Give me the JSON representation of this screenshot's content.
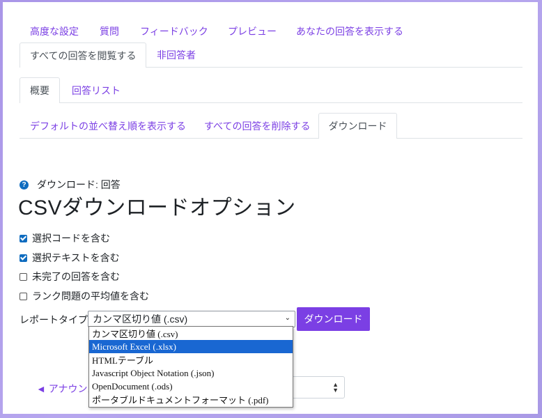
{
  "tabs_row1": [
    {
      "label": "高度な設定"
    },
    {
      "label": "質問"
    },
    {
      "label": "フィードバック"
    },
    {
      "label": "プレビュー"
    },
    {
      "label": "あなたの回答を表示する"
    }
  ],
  "tabs_row2": [
    {
      "label": "すべての回答を閲覧する",
      "active": true
    },
    {
      "label": "非回答者"
    }
  ],
  "tabs_row3": [
    {
      "label": "概要",
      "active": true
    },
    {
      "label": "回答リスト"
    }
  ],
  "tabs_row4": [
    {
      "label": "デフォルトの並べ替え順を表示する"
    },
    {
      "label": "すべての回答を削除する"
    },
    {
      "label": "ダウンロード",
      "active": true
    }
  ],
  "page": {
    "help_icon_glyph": "?",
    "subtitle": "ダウンロード: 回答",
    "title": "CSVダウンロードオプション"
  },
  "options": [
    {
      "label": "選択コードを含む",
      "checked": true
    },
    {
      "label": "選択テキストを含む",
      "checked": true
    },
    {
      "label": "未完了の回答を含む",
      "checked": false
    },
    {
      "label": "ランク問題の平均値を含む",
      "checked": false
    }
  ],
  "report": {
    "label": "レポートタイプ",
    "selected": "カンマ区切り値 (.csv)",
    "arrow": "⌄",
    "button": "ダウンロード"
  },
  "dropdown_options": [
    {
      "label": "カンマ区切り値 (.csv)",
      "highlighted": false
    },
    {
      "label": "Microsoft Excel (.xlsx)",
      "highlighted": true
    },
    {
      "label": "HTMLテーブル",
      "highlighted": false
    },
    {
      "label": "Javascript Object Notation (.json)",
      "highlighted": false
    },
    {
      "label": "OpenDocument (.ods)",
      "highlighted": false
    },
    {
      "label": "ポータブルドキュメントフォーマット (.pdf)",
      "highlighted": false
    }
  ],
  "footer": {
    "announce_link": "◄ アナウンス",
    "updown_glyph": "⬆⬇"
  },
  "colors": {
    "accent": "#7b3fe4",
    "checkbox": "#0f6cbf",
    "highlight": "#1967d2",
    "background_gradient": "#a995e8"
  }
}
